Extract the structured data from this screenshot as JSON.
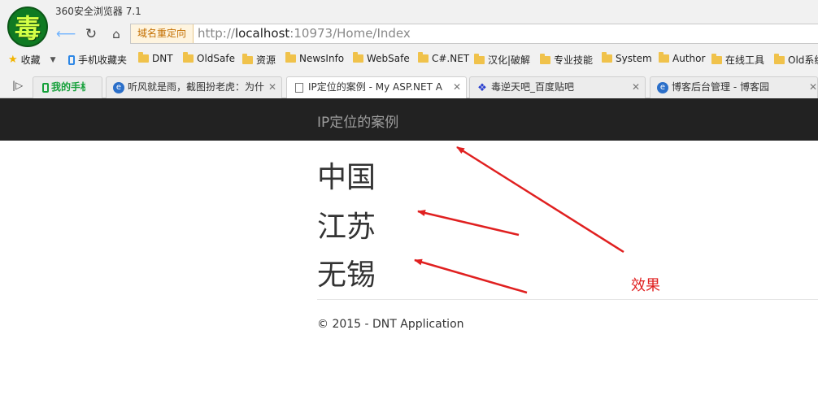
{
  "browser": {
    "title": "360安全浏览器 7.1",
    "logo_glyph": "毒",
    "redirect_label": "域名重定向",
    "url": {
      "scheme": "http://",
      "host": "localhost",
      "rest": ":10973/Home/Index"
    }
  },
  "bookmarks": [
    {
      "label": "收藏",
      "icon": "star-icon"
    },
    {
      "label": "手机收藏夹",
      "icon": "phone-icon"
    },
    {
      "label": "DNT",
      "icon": "folder-icon"
    },
    {
      "label": "OldSafe",
      "icon": "folder-icon"
    },
    {
      "label": "资源",
      "icon": "folder-icon"
    },
    {
      "label": "NewsInfo",
      "icon": "folder-icon"
    },
    {
      "label": "WebSafe",
      "icon": "folder-icon"
    },
    {
      "label": "C#.NET",
      "icon": "folder-icon"
    },
    {
      "label": "汉化|破解",
      "icon": "folder-icon"
    },
    {
      "label": "专业技能",
      "icon": "folder-icon"
    },
    {
      "label": "System",
      "icon": "folder-icon"
    },
    {
      "label": "Author",
      "icon": "folder-icon"
    },
    {
      "label": "在线工具",
      "icon": "folder-icon"
    },
    {
      "label": "Old系统",
      "icon": "folder-icon"
    }
  ],
  "tabs": [
    {
      "label": "我的手机",
      "icon": "phone-icon"
    },
    {
      "label": "听风就是雨，截图扮老虎：为什",
      "icon": "ie-icon"
    },
    {
      "label": "IP定位的案例 - My ASP.NET A",
      "icon": "document-icon",
      "active": true
    },
    {
      "label": "毒逆天吧_百度贴吧",
      "icon": "paw-icon"
    },
    {
      "label": "博客后台管理 - 博客园",
      "icon": "ie-icon"
    }
  ],
  "page": {
    "brand": "IP定位的案例",
    "country": "中国",
    "province": "江苏",
    "city": "无锡",
    "footer": "© 2015 - DNT Application",
    "annotation": "效果"
  },
  "colors": {
    "navbar": "#222222",
    "annotation": "#e02020",
    "brand_text": "#9d9d9d"
  }
}
